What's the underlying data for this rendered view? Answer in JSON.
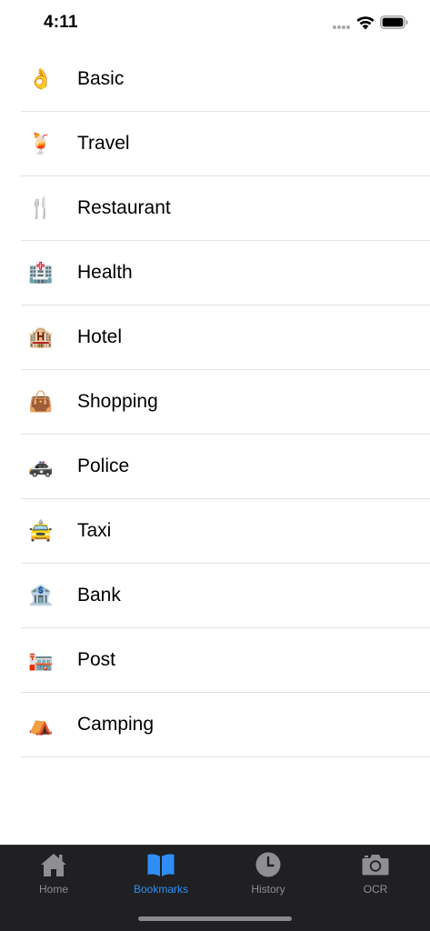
{
  "status_bar": {
    "time": "4:11"
  },
  "categories": [
    {
      "label": "Basic",
      "icon": "ok-hand-icon",
      "glyph": "👌"
    },
    {
      "label": "Travel",
      "icon": "tropical-drink-icon",
      "glyph": "🍹"
    },
    {
      "label": "Restaurant",
      "icon": "fork-and-knife-icon",
      "glyph": "🍴"
    },
    {
      "label": "Health",
      "icon": "hospital-icon",
      "glyph": "🏥"
    },
    {
      "label": "Hotel",
      "icon": "hotel-icon",
      "glyph": "🏨"
    },
    {
      "label": "Shopping",
      "icon": "handbag-icon",
      "glyph": "👜"
    },
    {
      "label": "Police",
      "icon": "police-car-icon",
      "glyph": "🚓"
    },
    {
      "label": "Taxi",
      "icon": "taxi-icon",
      "glyph": "🚖"
    },
    {
      "label": "Bank",
      "icon": "bank-icon",
      "glyph": "🏦"
    },
    {
      "label": "Post",
      "icon": "post-office-icon",
      "glyph": "🏣"
    },
    {
      "label": "Camping",
      "icon": "tent-icon",
      "glyph": "⛺"
    }
  ],
  "tab_bar": {
    "tabs": [
      {
        "label": "Home",
        "icon": "home-icon",
        "active": false
      },
      {
        "label": "Bookmarks",
        "icon": "book-icon",
        "active": true
      },
      {
        "label": "History",
        "icon": "clock-icon",
        "active": false
      },
      {
        "label": "OCR",
        "icon": "camera-icon",
        "active": false
      }
    ],
    "colors": {
      "background": "#202022",
      "active": "#2e8ef5",
      "inactive": "#8e8e93"
    }
  }
}
